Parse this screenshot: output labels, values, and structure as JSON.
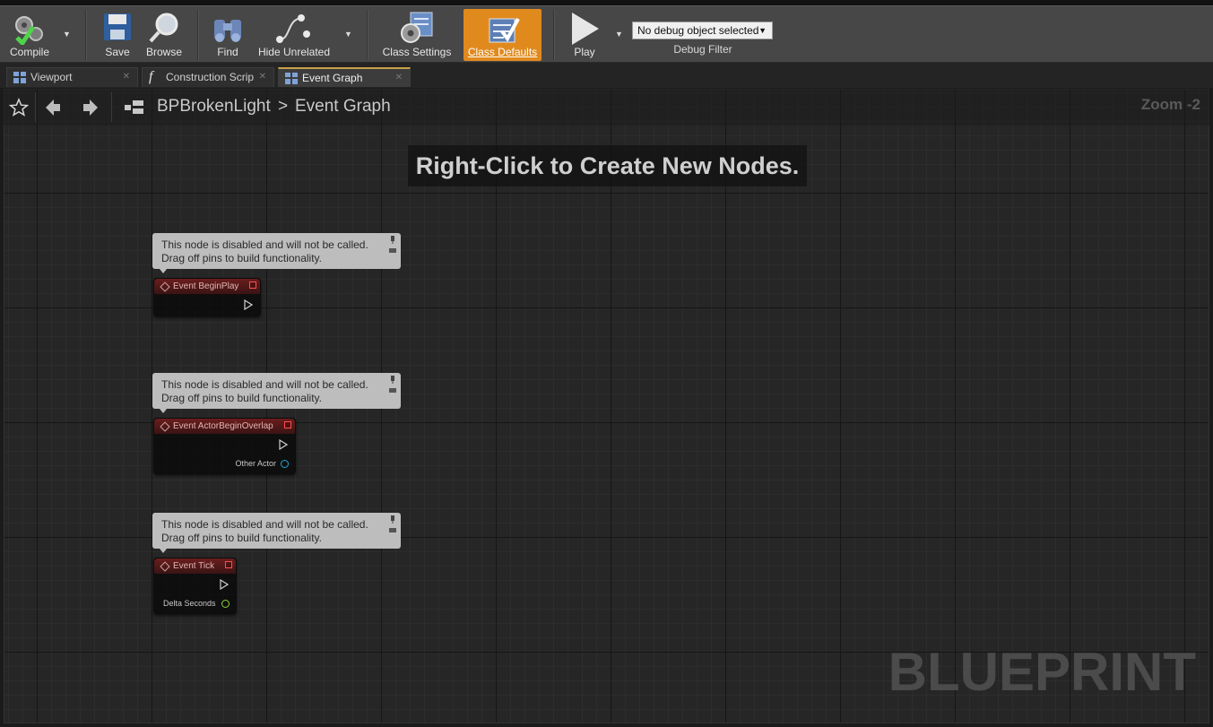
{
  "toolbar": {
    "compile": "Compile",
    "save": "Save",
    "browse": "Browse",
    "find": "Find",
    "hide_unrelated": "Hide Unrelated",
    "class_settings": "Class Settings",
    "class_defaults": "Class Defaults",
    "play": "Play",
    "debug_select": "No debug object selected",
    "debug_filter": "Debug Filter"
  },
  "tabs": [
    {
      "label": "Viewport"
    },
    {
      "label": "Construction Scrip"
    },
    {
      "label": "Event Graph"
    }
  ],
  "breadcrumb": {
    "root": "BPBrokenLight",
    "separator": ">",
    "current": "Event Graph"
  },
  "zoom": "Zoom -2",
  "hint": "Right-Click to Create New Nodes.",
  "comments": [
    {
      "line1": "This node is disabled and will not be called.",
      "line2": "Drag off pins to build functionality."
    },
    {
      "line1": "This node is disabled and will not be called.",
      "line2": "Drag off pins to build functionality."
    },
    {
      "line1": "This node is disabled and will not be called.",
      "line2": "Drag off pins to build functionality."
    }
  ],
  "nodes": [
    {
      "title": "Event BeginPlay"
    },
    {
      "title": "Event ActorBeginOverlap",
      "pin": "Other Actor"
    },
    {
      "title": "Event Tick",
      "pin": "Delta Seconds"
    }
  ],
  "watermark": "BLUEPRINT",
  "colors": {
    "accent": "#e08a1e",
    "event_header": "#6a1d1d",
    "object_pin": "#1da6d8",
    "float_pin": "#8ad53a"
  }
}
